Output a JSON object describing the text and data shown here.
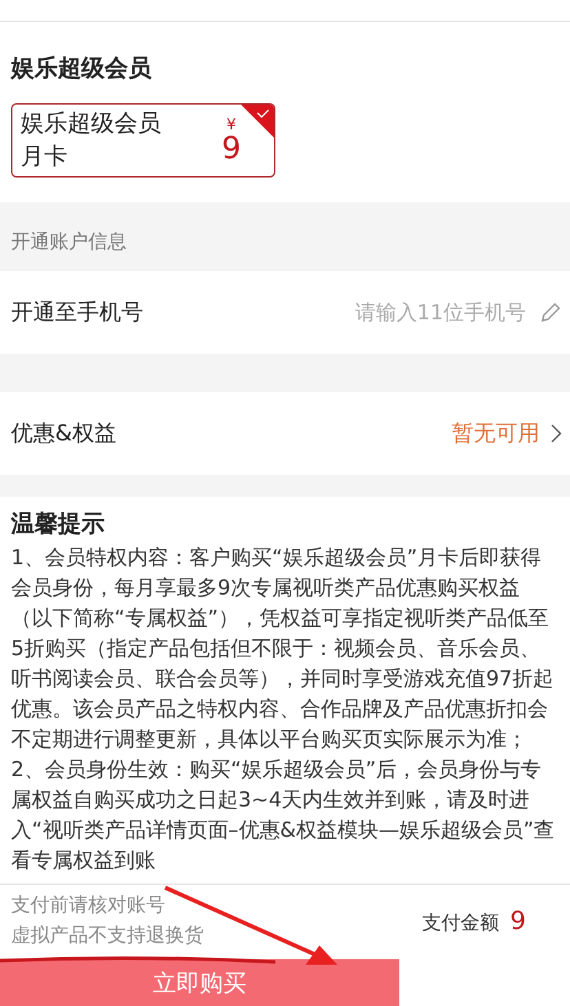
{
  "product": {
    "title": "娱乐超级会员",
    "options": [
      {
        "name": "娱乐超级会员月卡",
        "currency": "¥",
        "price": "9",
        "selected": true
      }
    ]
  },
  "account": {
    "section_title": "开通账户信息",
    "label": "开通至手机号",
    "placeholder": "请输入11位手机号"
  },
  "benefits": {
    "label": "优惠&权益",
    "value": "暂无可用"
  },
  "notice": {
    "title": "温馨提示",
    "paragraphs": [
      "1、会员特权内容：客户购买“娱乐超级会员”月卡后即获得会员身份，每月享最多9次专属视听类产品优惠购买权益（以下简称“专属权益”），凭权益可享指定视听类产品低至5折购买（指定产品包括但不限于：视频会员、音乐会员、听书阅读会员、联合会员等），并同时享受游戏充值97折起优惠。该会员产品之特权内容、合作品牌及产品优惠折扣会不定期进行调整更新，具体以平台购买页实际展示为准；",
      "2、会员身份生效：购买“娱乐超级会员”后，会员身份与专属权益自购买成功之日起3~4天内生效并到账，请及时进入“视听类产品详情页面–优惠&权益模块—娱乐超级会员”查看专属权益到账"
    ]
  },
  "footer": {
    "tips": [
      "支付前请核对账号",
      "虚拟产品不支持退换货"
    ],
    "amount_label": "支付金额",
    "amount": "9",
    "buy": "立即购买"
  }
}
